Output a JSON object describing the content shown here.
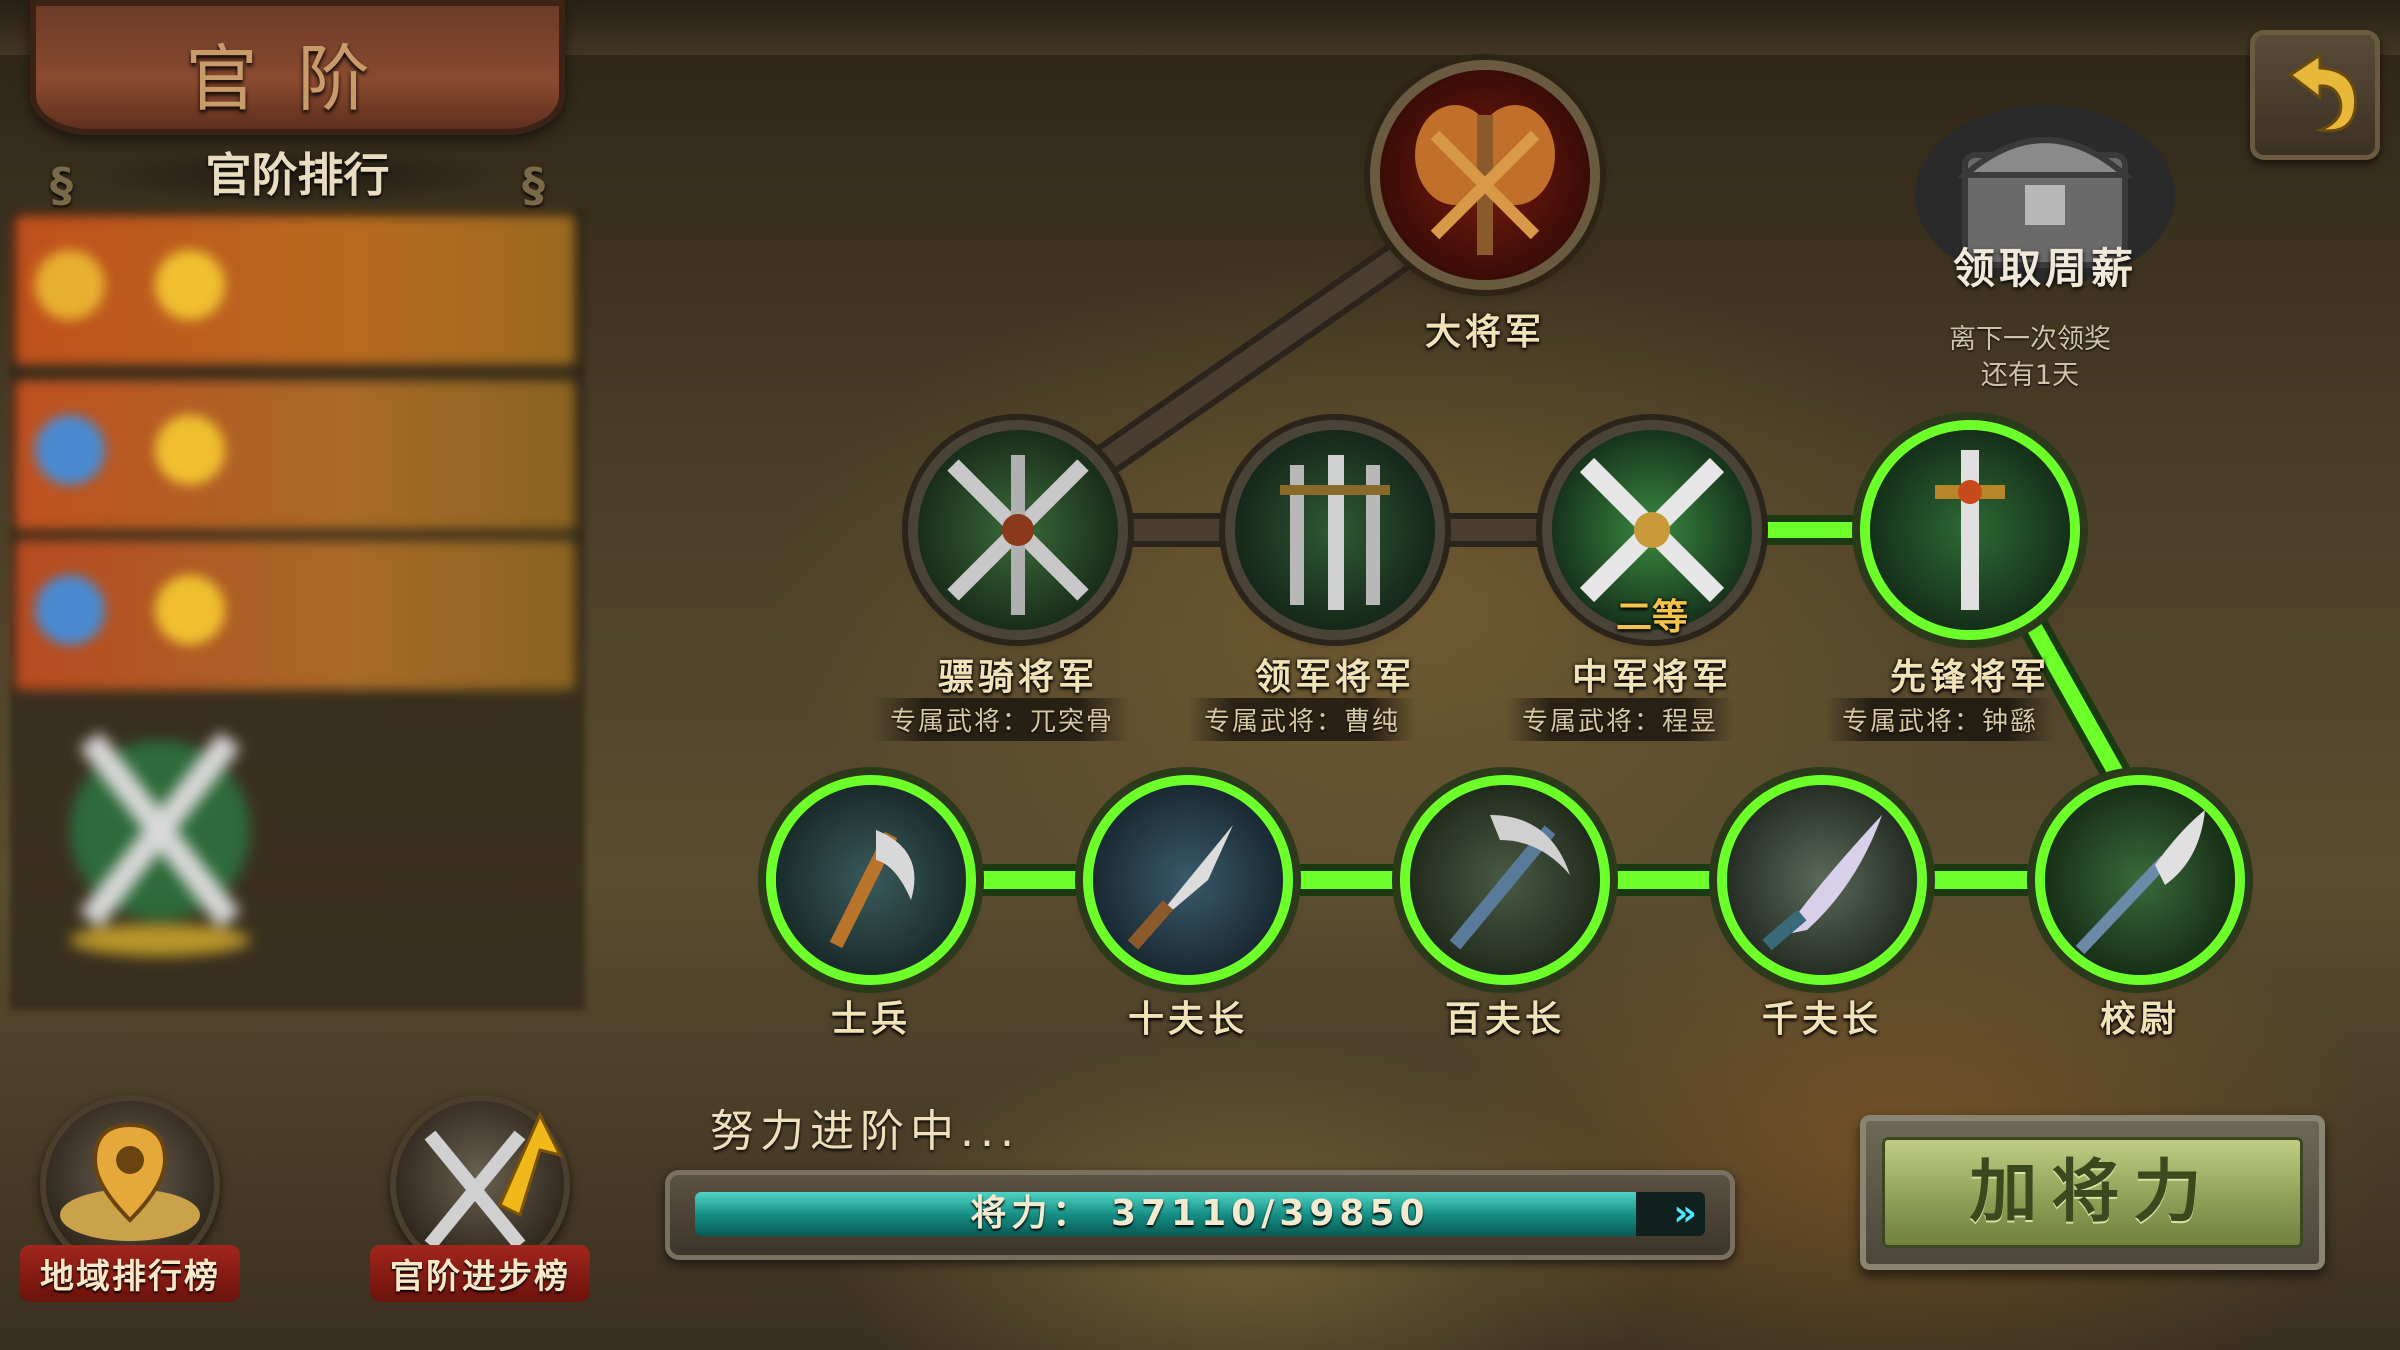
{
  "header": {
    "title": "官阶"
  },
  "ranking": {
    "title": "官阶排行"
  },
  "chest": {
    "label": "领取周薪",
    "note_line1": "离下一次领奖",
    "note_line2": "还有1天"
  },
  "top_rank": {
    "label": "大将军"
  },
  "generals": [
    {
      "label": "骠骑将军",
      "exclusive": "专属武将：兀突骨"
    },
    {
      "label": "领军将军",
      "exclusive": "专属武将：曹纯"
    },
    {
      "label": "中军将军",
      "exclusive": "专属武将：程昱",
      "tag": "二等"
    },
    {
      "label": "先锋将军",
      "exclusive": "专属武将：钟繇"
    }
  ],
  "soldiers": [
    {
      "label": "士兵"
    },
    {
      "label": "十夫长"
    },
    {
      "label": "百夫长"
    },
    {
      "label": "千夫长"
    },
    {
      "label": "校尉"
    }
  ],
  "buttons": {
    "region_rank": "地域排行榜",
    "rank_progress": "官阶进步榜",
    "add_power": "加将力"
  },
  "progress": {
    "label": "努力进阶中...",
    "text": "将力： 37110/39850",
    "current": 37110,
    "max": 39850
  },
  "colors": {
    "accent_green": "#6cff2a",
    "progress_teal": "#138a80",
    "button_olive": "#8fa158"
  }
}
